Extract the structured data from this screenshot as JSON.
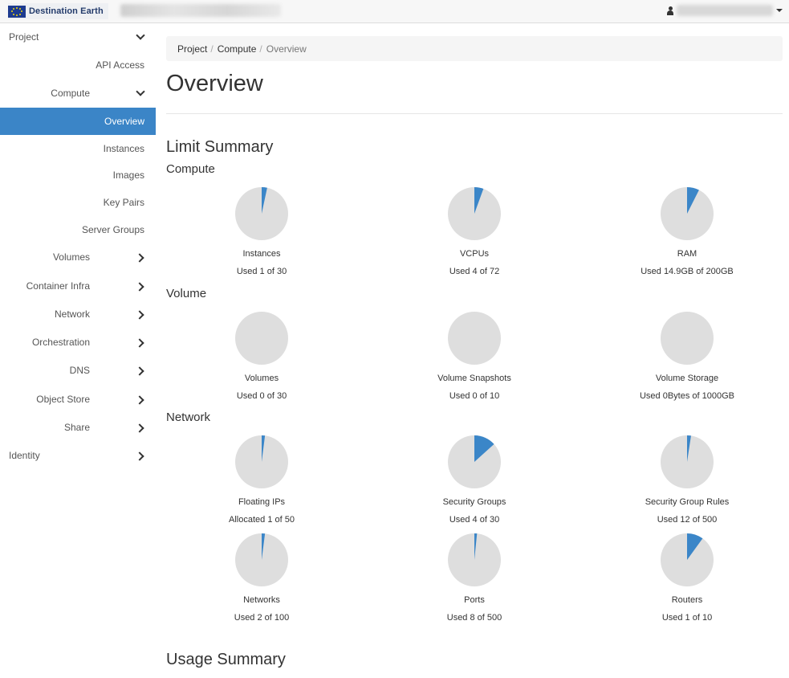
{
  "header": {
    "brand": "Destination Earth"
  },
  "sidebar": {
    "items": [
      {
        "label": "Project",
        "level": 0,
        "chevron": "down"
      },
      {
        "label": "API Access",
        "level": 2,
        "chevron": ""
      },
      {
        "label": "Compute",
        "level": 1,
        "chevron": "down"
      },
      {
        "label": "Overview",
        "level": 2,
        "chevron": "",
        "active": true
      },
      {
        "label": "Instances",
        "level": 2,
        "chevron": ""
      },
      {
        "label": "Images",
        "level": 2,
        "chevron": ""
      },
      {
        "label": "Key Pairs",
        "level": 2,
        "chevron": ""
      },
      {
        "label": "Server Groups",
        "level": 2,
        "chevron": ""
      },
      {
        "label": "Volumes",
        "level": 1,
        "chevron": "right"
      },
      {
        "label": "Container Infra",
        "level": 1,
        "chevron": "right"
      },
      {
        "label": "Network",
        "level": 1,
        "chevron": "right"
      },
      {
        "label": "Orchestration",
        "level": 1,
        "chevron": "right"
      },
      {
        "label": "DNS",
        "level": 1,
        "chevron": "right"
      },
      {
        "label": "Object Store",
        "level": 1,
        "chevron": "right"
      },
      {
        "label": "Share",
        "level": 1,
        "chevron": "right"
      },
      {
        "label": "Identity",
        "level": 0,
        "chevron": "right"
      }
    ]
  },
  "breadcrumb": {
    "items": [
      "Project",
      "Compute"
    ],
    "current": "Overview"
  },
  "page": {
    "title": "Overview",
    "limit_summary": "Limit Summary",
    "usage_summary": "Usage Summary"
  },
  "colors": {
    "used": "#3b86c8",
    "unused": "#dedede",
    "active_nav": "#3b85c7"
  },
  "limits": [
    {
      "section": "Compute",
      "charts": [
        {
          "name": "Instances",
          "usage": "Used 1 of 30",
          "used": 1,
          "total": 30
        },
        {
          "name": "VCPUs",
          "usage": "Used 4 of 72",
          "used": 4,
          "total": 72
        },
        {
          "name": "RAM",
          "usage": "Used 14.9GB of 200GB",
          "used": 14.9,
          "total": 200
        }
      ]
    },
    {
      "section": "Volume",
      "charts": [
        {
          "name": "Volumes",
          "usage": "Used 0 of 30",
          "used": 0,
          "total": 30
        },
        {
          "name": "Volume Snapshots",
          "usage": "Used 0 of 10",
          "used": 0,
          "total": 10
        },
        {
          "name": "Volume Storage",
          "usage": "Used 0Bytes of 1000GB",
          "used": 0,
          "total": 1000
        }
      ]
    },
    {
      "section": "Network",
      "charts": [
        {
          "name": "Floating IPs",
          "usage": "Allocated 1 of 50",
          "used": 1,
          "total": 50
        },
        {
          "name": "Security Groups",
          "usage": "Used 4 of 30",
          "used": 4,
          "total": 30
        },
        {
          "name": "Security Group Rules",
          "usage": "Used 12 of 500",
          "used": 12,
          "total": 500
        },
        {
          "name": "Networks",
          "usage": "Used 2 of 100",
          "used": 2,
          "total": 100
        },
        {
          "name": "Ports",
          "usage": "Used 8 of 500",
          "used": 8,
          "total": 500
        },
        {
          "name": "Routers",
          "usage": "Used 1 of 10",
          "used": 1,
          "total": 10
        }
      ]
    }
  ]
}
